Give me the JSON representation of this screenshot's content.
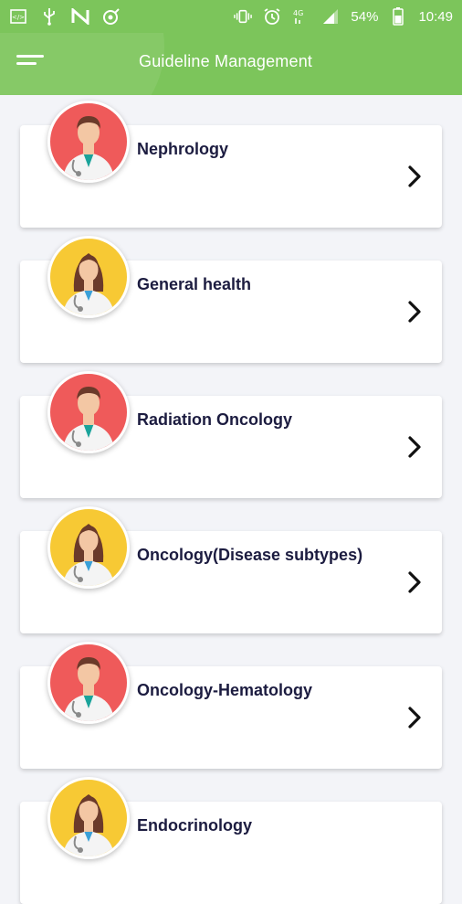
{
  "status_bar": {
    "battery": "54%",
    "time": "10:49",
    "left_icons": [
      "code-icon",
      "usb-icon",
      "n-app-icon",
      "location-target-icon"
    ],
    "right_icons": [
      "vibrate-icon",
      "alarm-icon",
      "signal-4g-icon",
      "signal-bars-icon",
      "battery-icon"
    ]
  },
  "appbar": {
    "title": "Guideline Management",
    "menu_icon": "hamburger-menu-icon",
    "color": "#7cc55b"
  },
  "list": {
    "items": [
      {
        "label": "Nephrology",
        "avatar": "male-doctor",
        "avatar_bg": "#ef5a5a"
      },
      {
        "label": "General health",
        "avatar": "female-doctor",
        "avatar_bg": "#f7c934"
      },
      {
        "label": "Radiation Oncology",
        "avatar": "male-doctor",
        "avatar_bg": "#ef5a5a"
      },
      {
        "label": "Oncology(Disease subtypes)",
        "avatar": "female-doctor",
        "avatar_bg": "#f7c934"
      },
      {
        "label": "Oncology-Hematology",
        "avatar": "male-doctor",
        "avatar_bg": "#ef5a5a"
      },
      {
        "label": "Endocrinology",
        "avatar": "female-doctor",
        "avatar_bg": "#f7c934"
      }
    ]
  }
}
